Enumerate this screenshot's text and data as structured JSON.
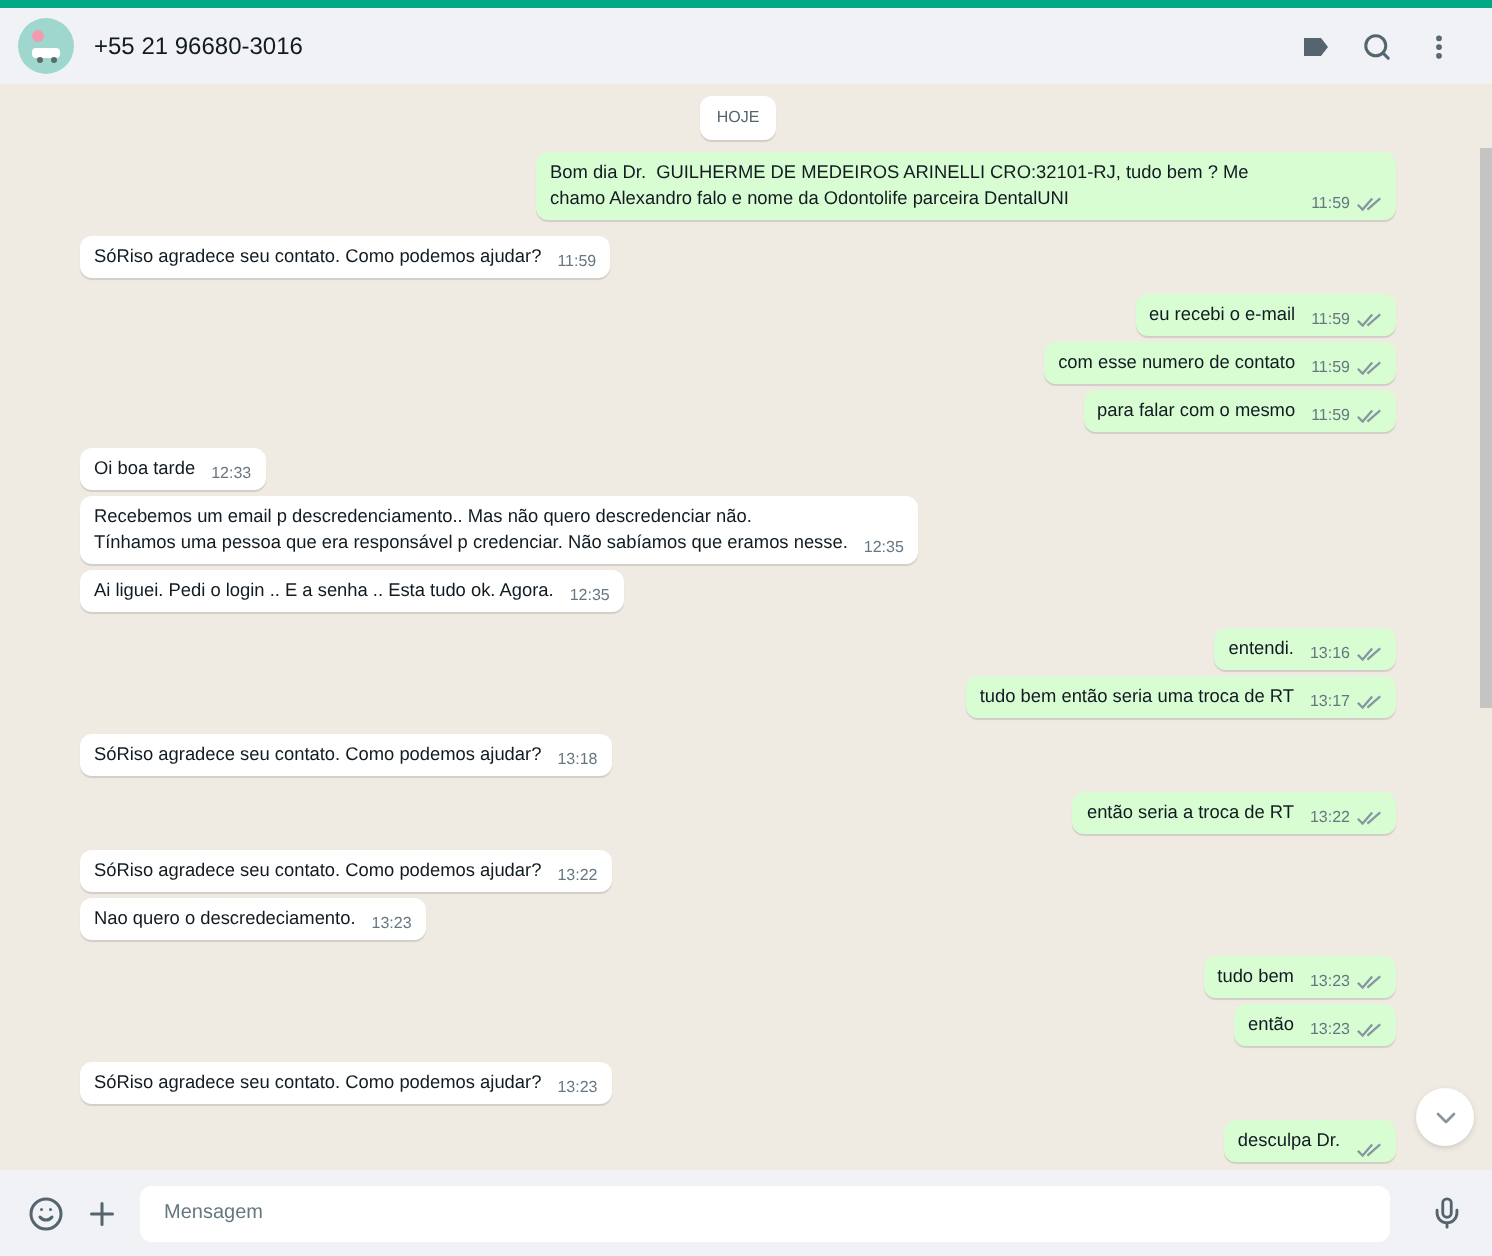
{
  "header": {
    "contact": "+55 21 96680-3016"
  },
  "date_chip": "HOJE",
  "groups": [
    {
      "outgoing": true,
      "messages": [
        {
          "text": "Bom dia Dr.  GUILHERME DE MEDEIROS ARINELLI CRO:32101-RJ, tudo bem ? Me chamo Alexandro falo e nome da Odontolife parceira DentalUNI",
          "time": "11:59",
          "read": true
        }
      ]
    },
    {
      "outgoing": false,
      "messages": [
        {
          "text": "SóRiso agradece seu contato. Como podemos ajudar?",
          "time": "11:59"
        }
      ]
    },
    {
      "outgoing": true,
      "messages": [
        {
          "text": "eu recebi o e-mail",
          "time": "11:59",
          "read": true
        },
        {
          "text": "com esse numero de contato",
          "time": "11:59",
          "read": true
        },
        {
          "text": "para falar com o mesmo",
          "time": "11:59",
          "read": true
        }
      ]
    },
    {
      "outgoing": false,
      "messages": [
        {
          "text": "Oi boa tarde",
          "time": "12:33"
        },
        {
          "text": "Recebemos um email p descredenciamento.. Mas não quero descredenciar não.\nTínhamos uma pessoa que era responsável p credenciar. Não sabíamos que eramos nesse.",
          "time": "12:35"
        },
        {
          "text": "Ai liguei. Pedi o login .. E a senha .. Esta tudo ok. Agora.",
          "time": "12:35"
        }
      ]
    },
    {
      "outgoing": true,
      "messages": [
        {
          "text": "entendi.",
          "time": "13:16",
          "read": true
        },
        {
          "text": "tudo bem então seria uma troca de RT",
          "time": "13:17",
          "read": true
        }
      ]
    },
    {
      "outgoing": false,
      "messages": [
        {
          "text": "SóRiso agradece seu contato. Como podemos ajudar?",
          "time": "13:18"
        }
      ]
    },
    {
      "outgoing": true,
      "messages": [
        {
          "text": "então seria a troca de RT",
          "time": "13:22",
          "read": true
        }
      ]
    },
    {
      "outgoing": false,
      "messages": [
        {
          "text": "SóRiso agradece seu contato. Como podemos ajudar?",
          "time": "13:22"
        },
        {
          "text": "Nao quero o descredeciamento.",
          "time": "13:23"
        }
      ]
    },
    {
      "outgoing": true,
      "messages": [
        {
          "text": "tudo bem",
          "time": "13:23",
          "read": true
        },
        {
          "text": "então",
          "time": "13:23",
          "read": true
        }
      ]
    },
    {
      "outgoing": false,
      "messages": [
        {
          "text": "SóRiso agradece seu contato. Como podemos ajudar?",
          "time": "13:23"
        }
      ]
    },
    {
      "outgoing": true,
      "messages": [
        {
          "text": "desculpa Dr.",
          "read": true
        }
      ]
    }
  ],
  "composer": {
    "placeholder": "Mensagem"
  }
}
